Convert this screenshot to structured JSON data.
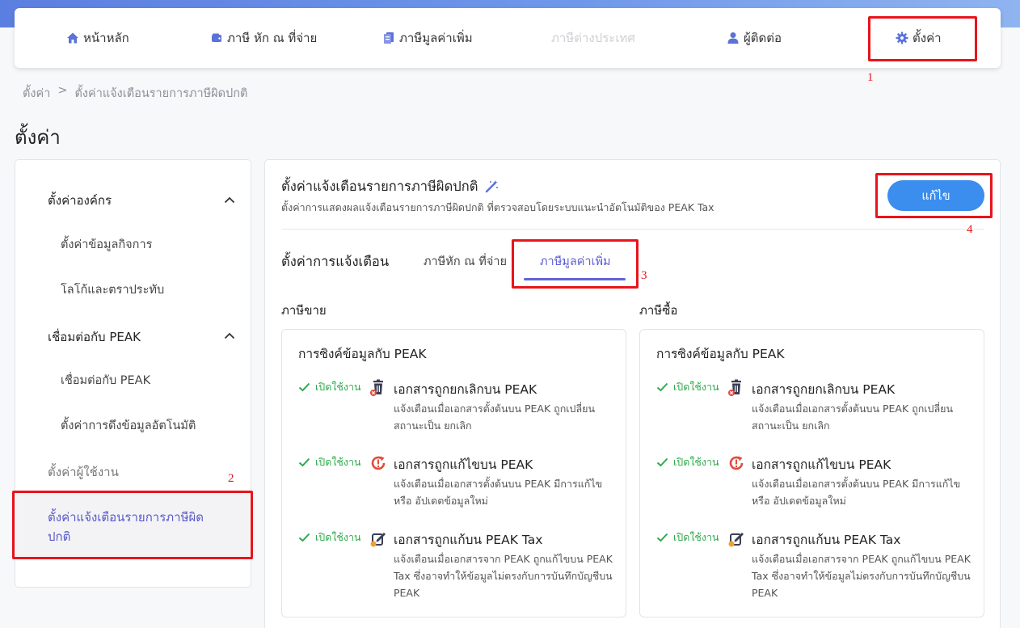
{
  "nav": {
    "home": "หน้าหลัก",
    "withholding": "ภาษี หัก ณ ที่จ่าย",
    "vat": "ภาษีมูลค่าเพิ่ม",
    "foreign": "ภาษีต่างประเทศ",
    "contacts": "ผู้ติดต่อ",
    "settings": "ตั้งค่า"
  },
  "breadcrumb": {
    "root": "ตั้งค่า",
    "sep": ">",
    "current": "ตั้งค่าแจ้งเตือนรายการภาษีผิดปกติ"
  },
  "page_title": "ตั้งค่า",
  "sidebar": {
    "org_group": "ตั้งค่าองค์กร",
    "business_info": "ตั้งค่าข้อมูลกิจการ",
    "logo_stamp": "โลโก้และตราประทับ",
    "peak_group": "เชื่อมต่อกับ PEAK",
    "peak_connect": "เชื่อมต่อกับ PEAK",
    "auto_fetch": "ตั้งค่าการดึงข้อมูลอัตโนมัติ",
    "users": "ตั้งค่าผู้ใช้งาน",
    "anomaly": "ตั้งค่าแจ้งเตือนรายการภาษีผิดปกติ"
  },
  "main": {
    "title": "ตั้งค่าแจ้งเตือนรายการภาษีผิดปกติ",
    "desc": "ตั้งค่าการแสดงผลแจ้งเตือนรายการภาษีผิดปกติ ที่ตรวจสอบโดยระบบแนะนำอัตโนมัติของ PEAK Tax",
    "edit_label": "แก้ไข",
    "tabs_label": "ตั้งค่าการแจ้งเตือน",
    "tab_withholding": "ภาษีหัก ณ ที่จ่าย",
    "tab_vat": "ภาษีมูลค่าเพิ่ม"
  },
  "sales": {
    "heading": "ภาษีขาย",
    "card_title": "การซิงค์ข้อมูลกับ PEAK",
    "rows": [
      {
        "status": "เปิดใช้งาน",
        "title": "เอกสารถูกยกเลิกบน PEAK",
        "desc": "แจ้งเตือนเมื่อเอกสารตั้งต้นบน PEAK ถูกเปลี่ยนสถานะเป็น ยกเลิก"
      },
      {
        "status": "เปิดใช้งาน",
        "title": "เอกสารถูกแก้ไขบน PEAK",
        "desc": "แจ้งเตือนเมื่อเอกสารตั้งต้นบน PEAK มีการแก้ไขหรือ อัปเดตข้อมูลใหม่"
      },
      {
        "status": "เปิดใช้งาน",
        "title": "เอกสารถูกแก้บน PEAK Tax",
        "desc": "แจ้งเตือนเมื่อเอกสารจาก PEAK ถูกแก้ไขบน PEAK Tax ซึ่งอาจทำให้ข้อมูลไม่ตรงกับการบันทึกบัญชีบน PEAK"
      }
    ]
  },
  "purchase": {
    "heading": "ภาษีซื้อ",
    "card_title": "การซิงค์ข้อมูลกับ PEAK",
    "rows": [
      {
        "status": "เปิดใช้งาน",
        "title": "เอกสารถูกยกเลิกบน PEAK",
        "desc": "แจ้งเตือนเมื่อเอกสารตั้งต้นบน PEAK ถูกเปลี่ยนสถานะเป็น ยกเลิก"
      },
      {
        "status": "เปิดใช้งาน",
        "title": "เอกสารถูกแก้ไขบน PEAK",
        "desc": "แจ้งเตือนเมื่อเอกสารตั้งต้นบน PEAK มีการแก้ไขหรือ อัปเดตข้อมูลใหม่"
      },
      {
        "status": "เปิดใช้งาน",
        "title": "เอกสารถูกแก้บน PEAK Tax",
        "desc": "แจ้งเตือนเมื่อเอกสารจาก PEAK ถูกแก้ไขบน PEAK Tax ซึ่งอาจทำให้ข้อมูลไม่ตรงกับการบันทึกบัญชีบน PEAK"
      }
    ]
  },
  "annotations": [
    "1",
    "2",
    "3",
    "4"
  ],
  "colors": {
    "accent": "#5a5bd4",
    "primary_button": "#3b8dee",
    "enabled_green": "#2eaa4a",
    "annotation_red": "#e8141b",
    "nav_icon": "#5b72d8"
  }
}
